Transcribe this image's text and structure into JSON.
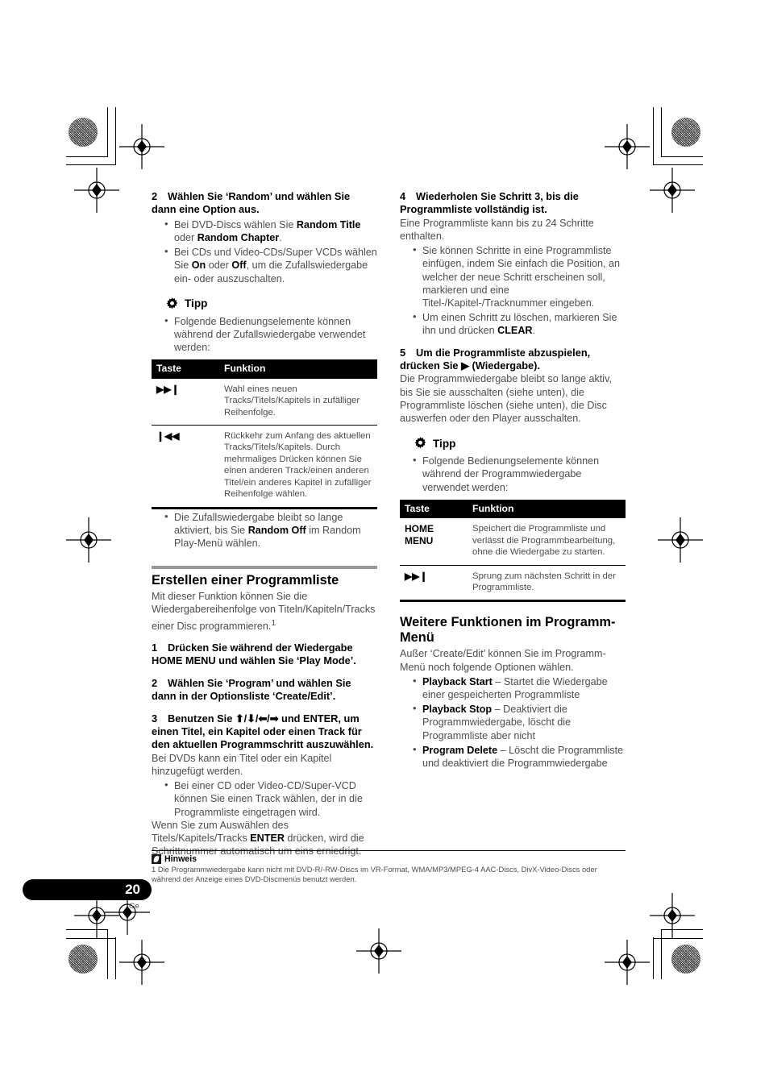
{
  "page": {
    "number": "20",
    "language_code": "Ge"
  },
  "left_column": {
    "step2": {
      "num": "2",
      "heading": "Wählen Sie ‘Random’ und wählen Sie dann eine Option aus.",
      "bullets": [
        "Bei DVD-Discs wählen Sie <b>Random Title</b> oder <b>Random Chapter</b>.",
        "Bei CDs und Video-CDs/Super VCDs wählen Sie <b>On</b> oder <b>Off</b>, um die Zufallswiedergabe ein- oder auszuschalten."
      ]
    },
    "tip": {
      "icon": "gear-icon",
      "label": "Tipp",
      "bullets": [
        "Folgende Bedienungselemente können während der Zufallswiedergabe verwendet werden:"
      ]
    },
    "table": {
      "columns": [
        "Taste",
        "Funktion"
      ],
      "rows": [
        {
          "key": "▶▶❙",
          "value": "Wahl eines neuen Tracks/Titels/Kapitels in zufälliger Reihenfolge."
        },
        {
          "key": "❙◀◀",
          "value": "Rückkehr zum Anfang des aktuellen Tracks/Titels/Kapitels. Durch mehrmaliges Drücken können Sie einen anderen Track/einen anderen Titel/ein anderes Kapitel in zufälliger Reihenfolge wählen."
        }
      ]
    },
    "after_table_bullets": [
      "Die Zufallswiedergabe bleibt so lange aktiviert, bis Sie <b>Random Off</b> im Random Play-Menü wählen."
    ],
    "section": {
      "title": "Erstellen einer Programmliste",
      "intro": "Mit dieser Funktion können Sie die Wiedergabereihenfolge von Titeln/Kapiteln/Tracks einer Disc programmieren.<sup>1</sup>",
      "step1": {
        "num": "1",
        "text": "Drücken Sie während der Wiedergabe HOME MENU und wählen Sie ‘Play Mode’."
      },
      "step2": {
        "num": "2",
        "text": "Wählen Sie ‘Program’ und wählen Sie dann in der Optionsliste ‘Create/Edit’."
      },
      "step3": {
        "num": "3",
        "text": "Benutzen Sie <span class=\"arrows\">⬆/⬇/⬅/➡</span> und ENTER, um einen Titel, ein Kapitel oder einen Track für den aktuellen Programmschritt auszuwählen."
      },
      "step3_body": "Bei DVDs kann ein Titel oder ein Kapitel hinzugefügt werden.",
      "step3_bullets": [
        "Bei einer CD oder Video-CD/Super-VCD können Sie einen Track wählen, der in die Programmliste eingetragen wird."
      ],
      "step3_tail": "Wenn Sie zum Auswählen des Titels/Kapitels/Tracks <b>ENTER</b> drücken, wird die Schrittnummer automatisch um eins erniedrigt."
    }
  },
  "right_column": {
    "step4": {
      "num": "4",
      "heading": "Wiederholen Sie Schritt 3, bis die Programmliste vollständig ist.",
      "body": "Eine Programmliste kann bis zu 24 Schritte enthalten.",
      "bullets": [
        "Sie können Schritte in eine Programmliste einfügen, indem Sie einfach die Position, an welcher der neue Schritt erscheinen soll, markieren und eine Titel-/Kapitel-/Tracknummer eingeben.",
        "Um einen Schritt zu löschen, markieren Sie ihn und drücken <b>CLEAR</b>."
      ]
    },
    "step5": {
      "num": "5",
      "heading": "Um die Programmliste abzuspielen, drücken Sie ▶ (Wiedergabe).",
      "body": "Die Programmwiedergabe bleibt so lange aktiv, bis Sie sie ausschalten (siehe unten), die Programmliste löschen (siehe unten), die Disc auswerfen oder den Player ausschalten."
    },
    "tip": {
      "icon": "gear-icon",
      "label": "Tipp",
      "bullets": [
        "Folgende Bedienungselemente können während der Programmwiedergabe verwendet werden:"
      ]
    },
    "table": {
      "columns": [
        "Taste",
        "Funktion"
      ],
      "rows": [
        {
          "key": "HOME MENU",
          "value": "Speichert die Programmliste und verlässt die Programmbearbeitung, ohne die Wiedergabe zu starten."
        },
        {
          "key": "▶▶❙",
          "value": "Sprung zum nächsten Schritt in der Programmliste."
        }
      ]
    },
    "section": {
      "title": "Weitere Funktionen im Programm-Menü",
      "intro": "Außer ‘Create/Edit’ können Sie im Programm-Menü noch folgende Optionen wählen.",
      "bullets": [
        "<b>Playback Start</b> – Startet die Wiedergabe einer gespeicherten Programmliste",
        "<b>Playback Stop</b> – Deaktiviert die Programmwiedergabe, löscht die Programmliste aber nicht",
        "<b>Program Delete</b> – Löscht die Programmliste und deaktiviert die Programmwiedergabe"
      ]
    }
  },
  "footnote": {
    "icon": "note-icon",
    "label": "Hinweis",
    "text": "1 Die Programmwiedergabe kann nicht mit DVD-R/-RW-Discs im VR-Format, WMA/MP3/MPEG-4 AAC-Discs, DivX-Video-Discs oder während der Anzeige eines DVD-Discmenüs benutzt werden."
  },
  "colors": {
    "text": "#4d4d4d",
    "bold": "#000000",
    "rule": "#9a9a9a",
    "table_header_bg": "#000000"
  }
}
